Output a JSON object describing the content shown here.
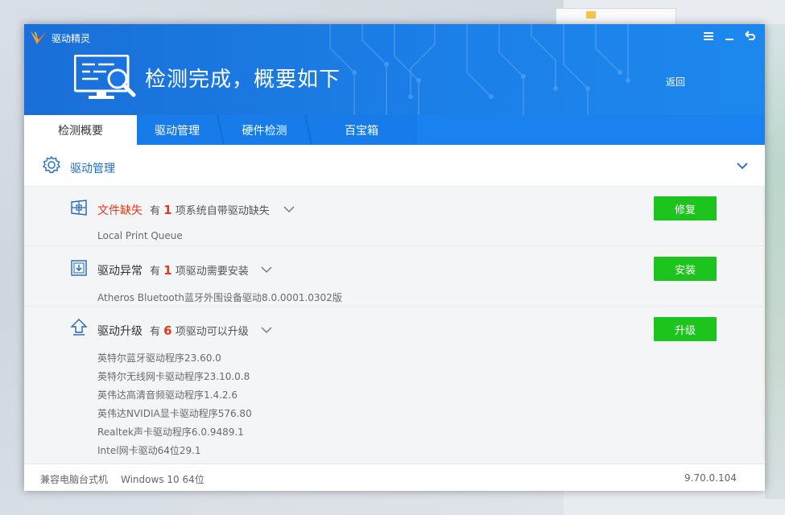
{
  "app": {
    "title": "驱动精灵",
    "brand_color": "#1a7de6",
    "window_controls": [
      "menu-icon",
      "minimize-icon",
      "back-arrow-icon"
    ]
  },
  "header": {
    "headline": "检测完成，概要如下",
    "back_label": "返回"
  },
  "tabs": [
    {
      "label": "检测概要",
      "active": true
    },
    {
      "label": "驱动管理",
      "active": false
    },
    {
      "label": "硬件检测",
      "active": false
    },
    {
      "label": "百宝箱",
      "active": false
    }
  ],
  "section": {
    "title": "驱动管理",
    "icon": "gear-icon"
  },
  "groups": [
    {
      "icon": "window-puzzle-icon",
      "title": "文件缺失",
      "title_color": "#e8391a",
      "prefix": "有",
      "count": "1",
      "suffix": "项系统自带驱动缺失",
      "button": "修复",
      "items": [
        "Local Print Queue"
      ]
    },
    {
      "icon": "download-box-icon",
      "title": "驱动异常",
      "prefix": "有",
      "count": "1",
      "suffix": "项驱动需要安装",
      "button": "安装",
      "items": [
        "Atheros Bluetooth蓝牙外围设备驱动8.0.0001.0302版"
      ]
    },
    {
      "icon": "upgrade-arrow-icon",
      "title": "驱动升级",
      "prefix": "有",
      "count": "6",
      "suffix": "项驱动可以升级",
      "button": "升级",
      "items": [
        "英特尔蓝牙驱动程序23.60.0",
        "英特尔无线网卡驱动程序23.10.0.8",
        "英伟达高清音频驱动程序1.4.2.6",
        "英伟达NVIDIA显卡驱动程序576.80",
        "Realtek声卡驱动程序6.0.9489.1",
        "Intel网卡驱动64位29.1"
      ]
    }
  ],
  "footer": {
    "model": "兼容电脑台式机",
    "os": "Windows 10 64位",
    "version": "9.70.0.104"
  },
  "colors": {
    "action_green": "#1ec41e",
    "count_red": "#e8391a",
    "link_blue": "#1c6bd0"
  }
}
